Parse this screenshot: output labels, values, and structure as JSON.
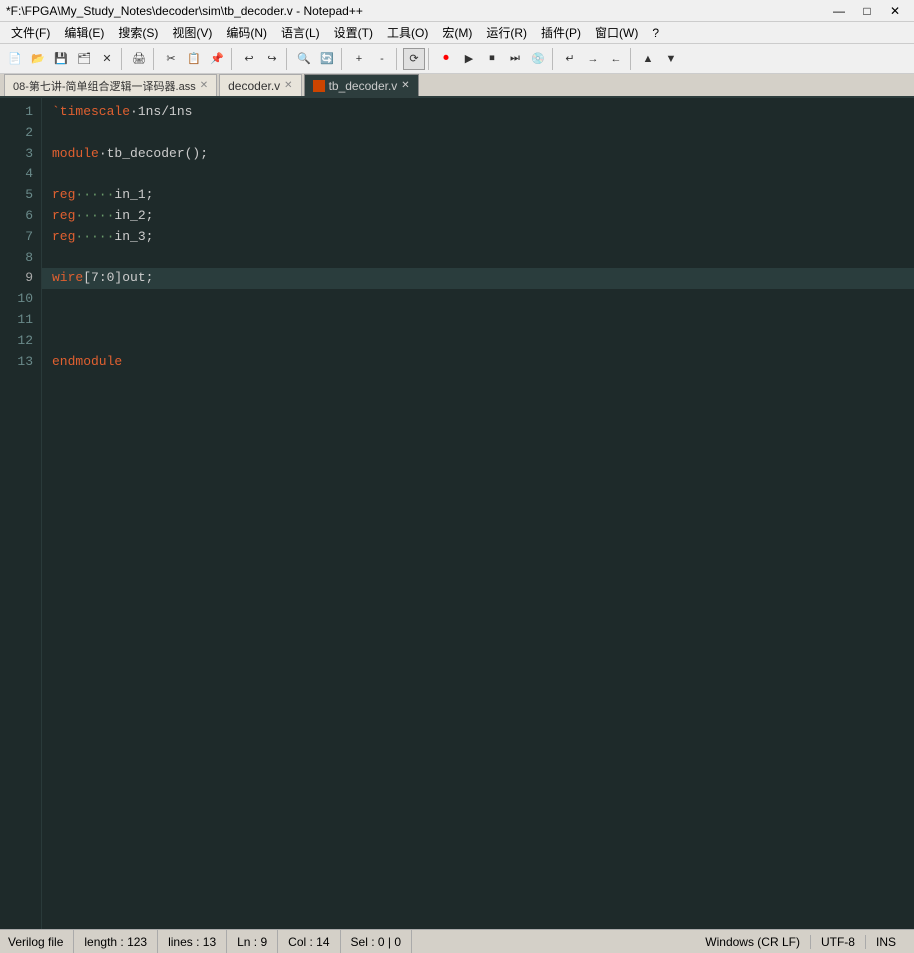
{
  "titlebar": {
    "title": "*F:\\FPGA\\My_Study_Notes\\decoder\\sim\\tb_decoder.v - Notepad++",
    "minimize": "—",
    "maximize": "□",
    "close": "✕"
  },
  "menubar": {
    "items": [
      "文件(F)",
      "编辑(E)",
      "搜索(S)",
      "视图(V)",
      "编码(N)",
      "语言(L)",
      "设置(T)",
      "工具(O)",
      "宏(M)",
      "运行(R)",
      "插件(P)",
      "窗口(W)",
      "?"
    ]
  },
  "tabs": [
    {
      "label": "08-第七讲-简单组合逻辑一译码器.ass",
      "active": false,
      "modified": false
    },
    {
      "label": "decoder.v",
      "active": false,
      "modified": false
    },
    {
      "label": "tb_decoder.v",
      "active": true,
      "modified": true
    }
  ],
  "editor": {
    "lines": [
      {
        "num": 1,
        "content": "`timescale 1ns/1ns",
        "type": "timescale"
      },
      {
        "num": 2,
        "content": "",
        "type": "empty"
      },
      {
        "num": 3,
        "content": "module tb_decoder();",
        "type": "module"
      },
      {
        "num": 4,
        "content": "",
        "type": "empty"
      },
      {
        "num": 5,
        "content": "reg     in_1;",
        "type": "reg"
      },
      {
        "num": 6,
        "content": "reg     in_2;",
        "type": "reg"
      },
      {
        "num": 7,
        "content": "reg     in_3;",
        "type": "reg"
      },
      {
        "num": 8,
        "content": "",
        "type": "empty"
      },
      {
        "num": 9,
        "content": "wire[7:0]out;",
        "type": "wire",
        "highlight": true
      },
      {
        "num": 10,
        "content": "",
        "type": "empty"
      },
      {
        "num": 11,
        "content": "",
        "type": "empty"
      },
      {
        "num": 12,
        "content": "endmodule",
        "type": "endmodule"
      },
      {
        "num": 13,
        "content": "",
        "type": "empty"
      }
    ]
  },
  "statusbar": {
    "file_type": "Verilog file",
    "length": "length : 123",
    "lines": "lines : 13",
    "cursor": "Ln : 9",
    "col": "Col : 14",
    "sel": "Sel : 0 | 0",
    "line_ending": "Windows (CR LF)",
    "encoding": "UTF-8",
    "mode": "INS"
  }
}
